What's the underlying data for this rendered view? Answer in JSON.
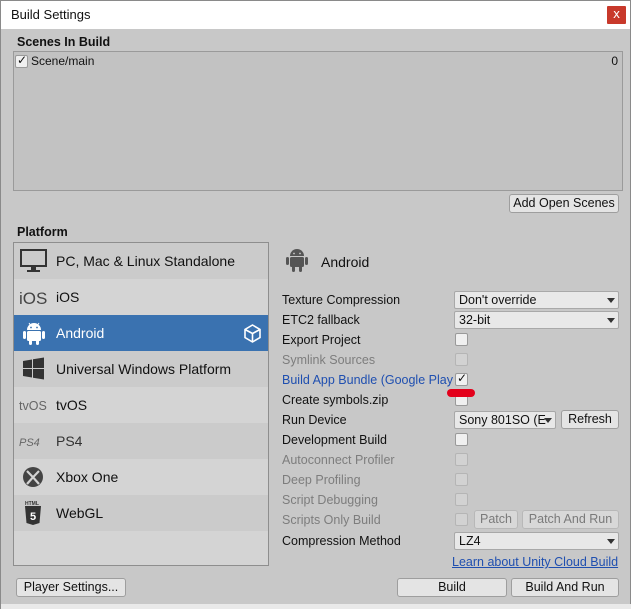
{
  "window": {
    "title": "Build Settings",
    "close_label": "x"
  },
  "scenes": {
    "section_label": "Scenes In Build",
    "items": [
      {
        "name": "Scene/main",
        "index": "0",
        "checked": true
      }
    ],
    "add_open_scenes_label": "Add Open Scenes"
  },
  "platform": {
    "section_label": "Platform",
    "items": [
      {
        "label": "PC, Mac & Linux Standalone",
        "icon": "monitor-icon"
      },
      {
        "label": "iOS",
        "icon": "ios-icon"
      },
      {
        "label": "Android",
        "icon": "android-icon",
        "selected": true,
        "active_badge": "unity-icon"
      },
      {
        "label": "Universal Windows Platform",
        "icon": "windows-icon"
      },
      {
        "label": "tvOS",
        "icon": "tvos-icon"
      },
      {
        "label": "PS4",
        "icon": "ps4-icon"
      },
      {
        "label": "Xbox One",
        "icon": "xbox-icon"
      },
      {
        "label": "WebGL",
        "icon": "html5-icon"
      }
    ],
    "icon_text": {
      "ios": "iOS",
      "tvos": "tvOS",
      "ps4": "PS4",
      "html": "HTML"
    }
  },
  "settings": {
    "header_title": "Android",
    "texture_compression": {
      "label": "Texture Compression",
      "value": "Don't override"
    },
    "etc2_fallback": {
      "label": "ETC2 fallback",
      "value": "32-bit"
    },
    "export_project": {
      "label": "Export Project",
      "checked": false
    },
    "symlink_sources": {
      "label": "Symlink Sources",
      "checked": false,
      "disabled": true
    },
    "build_app_bundle": {
      "label": "Build App Bundle (Google Play",
      "checked": true
    },
    "create_symbols": {
      "label": "Create symbols.zip",
      "checked": false
    },
    "run_device": {
      "label": "Run Device",
      "value": "Sony 801SO (E",
      "refresh_label": "Refresh"
    },
    "development_build": {
      "label": "Development Build",
      "checked": false
    },
    "autoconnect_profiler": {
      "label": "Autoconnect Profiler",
      "disabled": true
    },
    "deep_profiling": {
      "label": "Deep Profiling",
      "disabled": true
    },
    "script_debugging": {
      "label": "Script Debugging",
      "disabled": true
    },
    "scripts_only_build": {
      "label": "Scripts Only Build",
      "disabled": true,
      "patch_label": "Patch",
      "patch_and_run_label": "Patch And Run"
    },
    "compression_method": {
      "label": "Compression Method",
      "value": "LZ4"
    },
    "cloud_build_link": "Learn about Unity Cloud Build"
  },
  "footer": {
    "player_settings_label": "Player Settings...",
    "build_label": "Build",
    "build_and_run_label": "Build And Run"
  },
  "colors": {
    "selected_row": "#3a72b0",
    "link": "#1f4fb0",
    "close": "#c8392b",
    "annotation": "#e3001b"
  }
}
